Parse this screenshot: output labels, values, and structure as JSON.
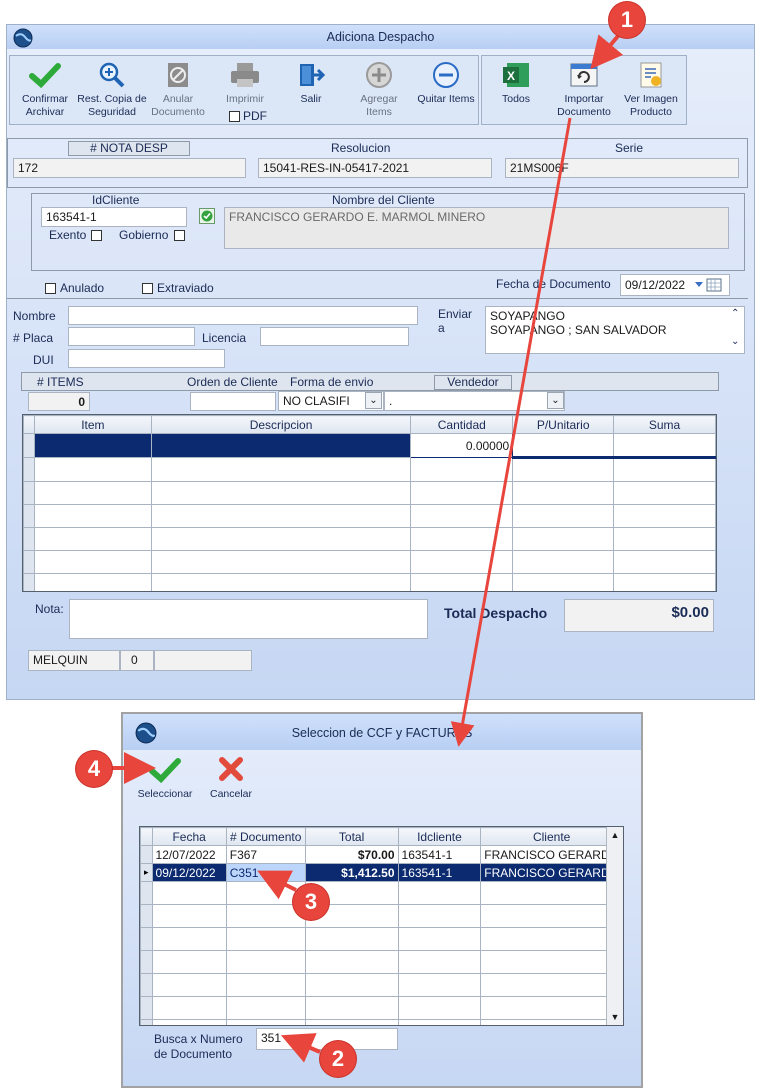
{
  "main": {
    "title": "Adiciona Despacho",
    "toolbar": {
      "confirm": "Confirmar Archivar",
      "restore": "Rest. Copia de Seguridad",
      "cancel_doc": "Anular Documento",
      "print": "Imprimir",
      "pdf": "PDF",
      "exit": "Salir",
      "add_items": "Agregar Items",
      "remove_items": "Quitar Items",
      "all": "Todos",
      "import_doc": "Importar Documento",
      "view_image": "Ver Imagen Producto"
    },
    "header": {
      "nota_label": "# NOTA DESP",
      "nota_value": "172",
      "resolucion_label": "Resolucion",
      "resolucion_value": "15041-RES-IN-05417-2021",
      "serie_label": "Serie",
      "serie_value": "21MS006F"
    },
    "client": {
      "id_label": "IdCliente",
      "id_value": "163541-1",
      "exento_label": "Exento",
      "gobierno_label": "Gobierno",
      "name_label": "Nombre del Cliente",
      "name_value": "FRANCISCO GERARDO E. MARMOL MINERO"
    },
    "status": {
      "anulado_label": "Anulado",
      "extraviado_label": "Extraviado",
      "fecha_label": "Fecha de Documento",
      "fecha_value": "09/12/2022"
    },
    "shipping": {
      "nombre_label": "Nombre",
      "placa_label": "# Placa",
      "licencia_label": "Licencia",
      "dui_label": "DUI",
      "enviar_label": "Enviar a",
      "enviar_line1": "SOYAPANGO",
      "enviar_line2": "SOYAPANGO ; SAN SALVADOR"
    },
    "items_header": {
      "items_label": "# ITEMS",
      "items_value": "0",
      "orden_label": "Orden de Cliente",
      "forma_label": "Forma de envio",
      "forma_value": "NO CLASIFI",
      "dot_value": ".",
      "vendedor_label": "Vendedor"
    },
    "grid": {
      "columns": [
        "Item",
        "Descripcion",
        "Cantidad",
        "P/Unitario",
        "Suma"
      ],
      "first_qty": "0.00000"
    },
    "footer": {
      "nota_label": "Nota:",
      "total_label": "Total Despacho",
      "total_value": "$0.00",
      "user": "MELQUIN",
      "user_num": "0"
    }
  },
  "dialog": {
    "title": "Seleccion de CCF y FACTURAS",
    "select_label": "Seleccionar",
    "cancel_label": "Cancelar",
    "columns": [
      "Fecha",
      "# Documento",
      "Total",
      "Idcliente",
      "Cliente"
    ],
    "rows": [
      {
        "fecha": "12/07/2022",
        "doc": "F367",
        "total": "$70.00",
        "idcliente": "163541-1",
        "cliente": "FRANCISCO GERARDO"
      },
      {
        "fecha": "09/12/2022",
        "doc": "C351",
        "total": "$1,412.50",
        "idcliente": "163541-1",
        "cliente": "FRANCISCO GERARDO"
      }
    ],
    "search_label": "Busca x Numero de Documento",
    "search_value": "351"
  },
  "callouts": [
    "1",
    "2",
    "3",
    "4"
  ],
  "colors": {
    "callout": "#e8453c",
    "selection": "#0b2a6f",
    "window_bg": "#c6d7f3"
  }
}
